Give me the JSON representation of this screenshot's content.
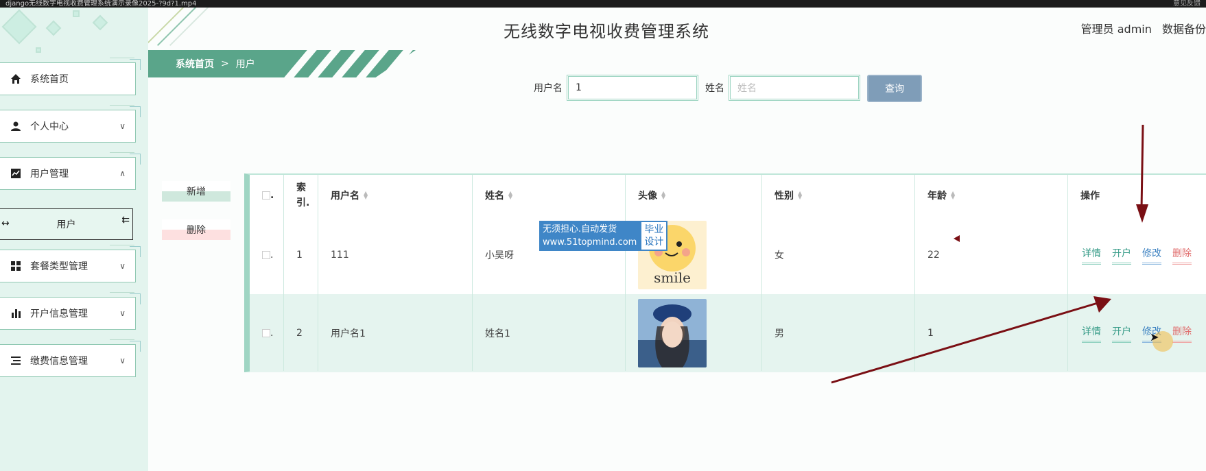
{
  "titlebar": {
    "text": "django无线数字电视收费管理系统演示录像2025-?9d?1.mp4",
    "right": "意见反馈"
  },
  "header": {
    "title": "无线数字电视收费管理系统",
    "user": "管理员 admin",
    "backup": "数据备份"
  },
  "breadcrumb": {
    "home": "系统首页",
    "sep": ">",
    "current": "用户"
  },
  "sidebar": {
    "items": [
      {
        "label": "系统首页",
        "icon": "home-icon"
      },
      {
        "label": "个人中心",
        "icon": "person-icon",
        "chevron": "∨"
      },
      {
        "label": "用户管理",
        "icon": "chart-icon",
        "chevron": "∧"
      },
      {
        "label": "套餐类型管理",
        "icon": "grid-icon",
        "chevron": "∨"
      },
      {
        "label": "开户信息管理",
        "icon": "bar-chart-icon",
        "chevron": "∨"
      },
      {
        "label": "缴费信息管理",
        "icon": "list-icon",
        "chevron": "∨"
      }
    ],
    "submenu": {
      "label": "用户"
    }
  },
  "search": {
    "username_label": "用户名",
    "username_value": "1",
    "name_label": "姓名",
    "name_placeholder": "姓名",
    "button": "查询"
  },
  "actions": {
    "add": "新增",
    "delete": "删除"
  },
  "table": {
    "headers": {
      "check": ".",
      "index": "索引.",
      "username": "用户名",
      "name": "姓名",
      "avatar": "头像",
      "gender": "性别",
      "age": "年龄",
      "ops": "操作"
    },
    "rows": [
      {
        "check": ".",
        "index": "1",
        "username": "111",
        "name": "小吴呀",
        "gender": "女",
        "age": "22",
        "avatar_text": "smile"
      },
      {
        "check": ".",
        "index": "2",
        "username": "用户名1",
        "name": "姓名1",
        "gender": "男",
        "age": "1",
        "avatar_text": ""
      }
    ],
    "op_labels": {
      "detail": "详情",
      "open": "开户",
      "edit": "修改",
      "remove": "删除"
    }
  },
  "watermark": {
    "line1": "无须担心.自动发货",
    "line2": "www.51topmind.com",
    "right1": "毕业",
    "right2": "设计"
  },
  "colors": {
    "primary": "#5aa58a",
    "sidebar_bg": "#e3f4ee",
    "search_btn": "#7f9db8",
    "arrow": "#7a0f14"
  }
}
